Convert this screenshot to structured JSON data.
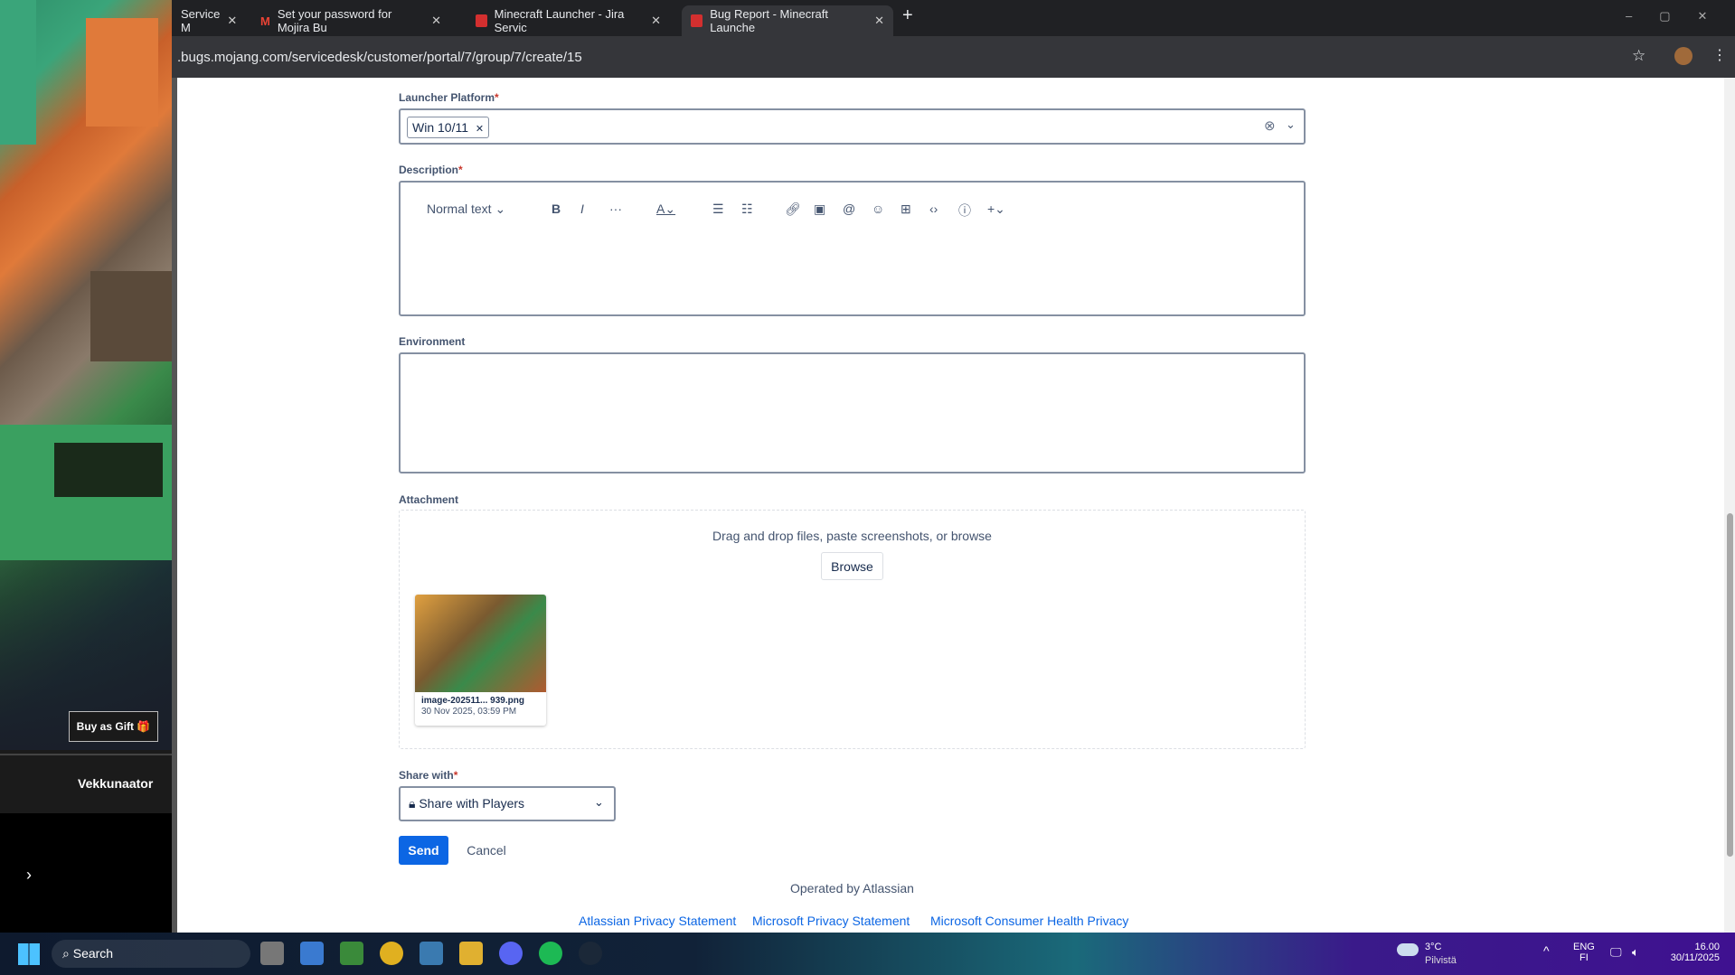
{
  "browser": {
    "tabs": [
      {
        "title": "Service M",
        "active": false
      },
      {
        "title": "Set your password for Mojira Bu",
        "active": false
      },
      {
        "title": "Minecraft Launcher - Jira Servic",
        "active": false
      },
      {
        "title": "Bug Report - Minecraft Launche",
        "active": true
      }
    ],
    "new_tab": "+",
    "url": ".bugs.mojang.com/servicedesk/customer/portal/7/group/7/create/15"
  },
  "left_panel": {
    "buy_gift": "Buy as Gift",
    "title": "Vekkunaator"
  },
  "form": {
    "launcher_platform": {
      "label": "Launcher Platform",
      "required": "*",
      "chip": "Win 10/11"
    },
    "description": {
      "label": "Description",
      "required": "*",
      "toolbar": {
        "text_style": "Normal text"
      },
      "value": ""
    },
    "environment": {
      "label": "Environment",
      "value": ""
    },
    "attachment": {
      "label": "Attachment",
      "drop_text": "Drag and drop files, paste screenshots, or browse",
      "browse": "Browse",
      "file": {
        "name": "image-202511... 939.png",
        "date": "30 Nov 2025, 03:59 PM"
      }
    },
    "share_with": {
      "label": "Share with",
      "required": "*",
      "value": "Share with Players"
    },
    "send": "Send",
    "cancel": "Cancel"
  },
  "footer": {
    "operated": "Operated by Atlassian",
    "links": [
      "Atlassian Privacy Statement",
      "Microsoft Privacy Statement",
      "Microsoft Consumer Health Privacy"
    ]
  },
  "taskbar": {
    "search": "Search",
    "weather_temp": "3°C",
    "weather_desc": "Pilvistä",
    "lang1": "ENG",
    "lang2": "FI",
    "time": "16.00",
    "date": "30/11/2025"
  },
  "colors": {
    "accent": "#0c66e4",
    "required": "#c9372c"
  }
}
